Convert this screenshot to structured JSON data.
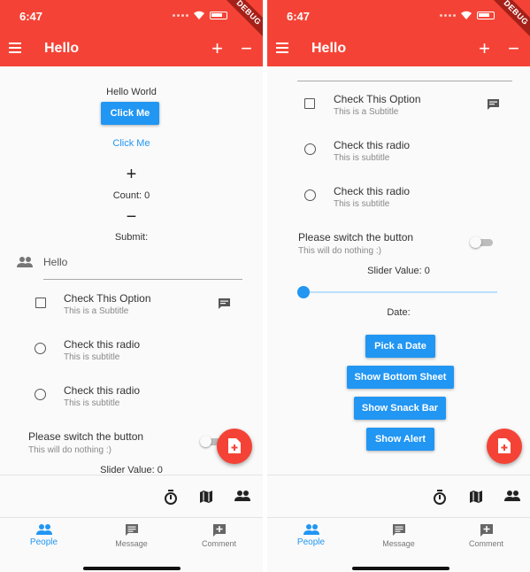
{
  "status_bar": {
    "time": "6:47",
    "debug_banner": "DEBUG"
  },
  "app_bar": {
    "title": "Hello"
  },
  "colors": {
    "primary": "#f44336",
    "accent": "#2196f3"
  },
  "left": {
    "hello_world": "Hello World",
    "click_me_button": "Click Me",
    "click_me_link": "Click Me",
    "plus": "+",
    "count_label": "Count: 0",
    "minus": "−",
    "submit_label": "Submit:",
    "text_field_value": "Hello",
    "check_option": {
      "title": "Check This Option",
      "subtitle": "This is a Subtitle"
    },
    "radio_1": {
      "title": "Check this radio",
      "subtitle": "This is subtitle"
    },
    "radio_2": {
      "title": "Check this radio",
      "subtitle": "This is subtitle"
    },
    "switch": {
      "title": "Please switch the button",
      "subtitle": "This will do nothing :)"
    },
    "slider_label": "Slider Value: 0"
  },
  "right": {
    "check_option": {
      "title": "Check This Option",
      "subtitle": "This is a Subtitle"
    },
    "radio_1": {
      "title": "Check this radio",
      "subtitle": "This is subtitle"
    },
    "radio_2": {
      "title": "Check this radio",
      "subtitle": "This is subtitle"
    },
    "switch": {
      "title": "Please switch the button",
      "subtitle": "This will do nothing :)"
    },
    "slider_label": "Slider Value: 0",
    "slider_value": 0,
    "date_label": "Date:",
    "buttons": {
      "pick_date": "Pick a Date",
      "bottom_sheet": "Show Bottom Sheet",
      "snack_bar": "Show Snack Bar",
      "alert": "Show Alert"
    }
  },
  "toolbar_icons": [
    "timer-icon",
    "map-icon",
    "people-icon"
  ],
  "bottom_nav": {
    "items": [
      {
        "label": "People",
        "icon": "people-icon",
        "active": true
      },
      {
        "label": "Message",
        "icon": "message-icon",
        "active": false
      },
      {
        "label": "Comment",
        "icon": "add-comment-icon",
        "active": false
      }
    ]
  }
}
